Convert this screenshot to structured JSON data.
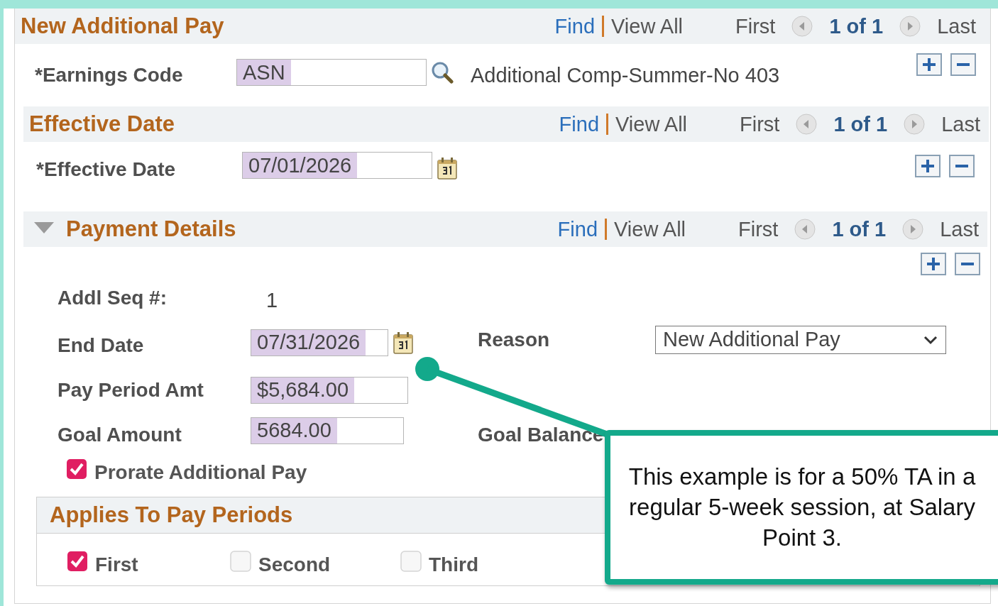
{
  "additional_pay": {
    "title": "New Additional Pay",
    "nav": {
      "find": "Find",
      "view_all": "View All",
      "first": "First",
      "count": "1 of 1",
      "last": "Last"
    },
    "earnings_code": {
      "label": "*Earnings Code",
      "value": "ASN",
      "highlighted": true,
      "description": "Additional Comp-Summer-No 403"
    }
  },
  "effective_date": {
    "title": "Effective Date",
    "nav": {
      "find": "Find",
      "view_all": "View All",
      "first": "First",
      "count": "1 of 1",
      "last": "Last"
    },
    "field": {
      "label": "*Effective Date",
      "value": "07/01/2026",
      "highlighted": true
    }
  },
  "payment_details": {
    "title": "Payment Details",
    "expanded": true,
    "nav": {
      "find": "Find",
      "view_all": "View All",
      "first": "First",
      "count": "1 of 1",
      "last": "Last"
    },
    "addl_seq": {
      "label": "Addl Seq #:",
      "value": "1"
    },
    "end_date": {
      "label": "End Date",
      "value": "07/31/2026",
      "highlighted": true
    },
    "reason": {
      "label": "Reason",
      "value": "New Additional Pay"
    },
    "pay_period_amt": {
      "label": "Pay Period Amt",
      "value": "$5,684.00",
      "highlighted": true
    },
    "goal_amount": {
      "label": "Goal Amount",
      "value": "5684.00",
      "highlighted": true
    },
    "goal_balance": {
      "label": "Goal Balance"
    },
    "prorate": {
      "label": "Prorate Additional Pay",
      "checked": true
    }
  },
  "applies_to": {
    "title": "Applies To Pay Periods",
    "periods": [
      {
        "label": "First",
        "checked": true
      },
      {
        "label": "Second",
        "checked": false
      },
      {
        "label": "Third",
        "checked": false
      }
    ]
  },
  "callout": {
    "text": "This example is for a 50% TA in a regular 5-week session, at Salary Point 3."
  }
}
